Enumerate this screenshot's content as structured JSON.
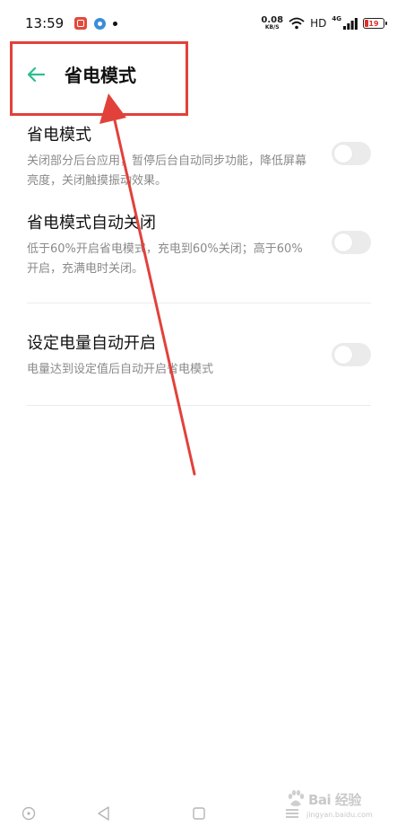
{
  "status_bar": {
    "time": "13:59",
    "net_speed_value": "0.08",
    "net_speed_unit": "KB/S",
    "network_type": "4G",
    "hd_label": "HD",
    "battery_level": "19",
    "battery_fraction": 0.19,
    "battery_color": "#e0302a"
  },
  "header": {
    "back_icon": "arrow-left-icon",
    "title": "省电模式"
  },
  "settings": [
    {
      "title": "省电模式",
      "description": "关闭部分后台应用，暂停后台自动同步功能，降低屏幕亮度，关闭触摸振动效果。",
      "enabled": false
    },
    {
      "title": "省电模式自动关闭",
      "description": "低于60%开启省电模式，充电到60%关闭；高于60%开启，充满电时关闭。",
      "enabled": false
    },
    {
      "title": "设定电量自动开启",
      "description": "电量达到设定值后自动开启省电模式",
      "enabled": false
    }
  ],
  "nav_bar": {
    "icons": [
      "circle-icon",
      "triangle-back-icon",
      "square-recents-icon",
      "menu-icon"
    ]
  },
  "watermark": {
    "brand": "Bai 经验",
    "url": "jingyan.baidu.com"
  },
  "colors": {
    "accent": "#2bbf8a",
    "annotation": "#e2413b",
    "toggle_off": "#ebebeb"
  }
}
